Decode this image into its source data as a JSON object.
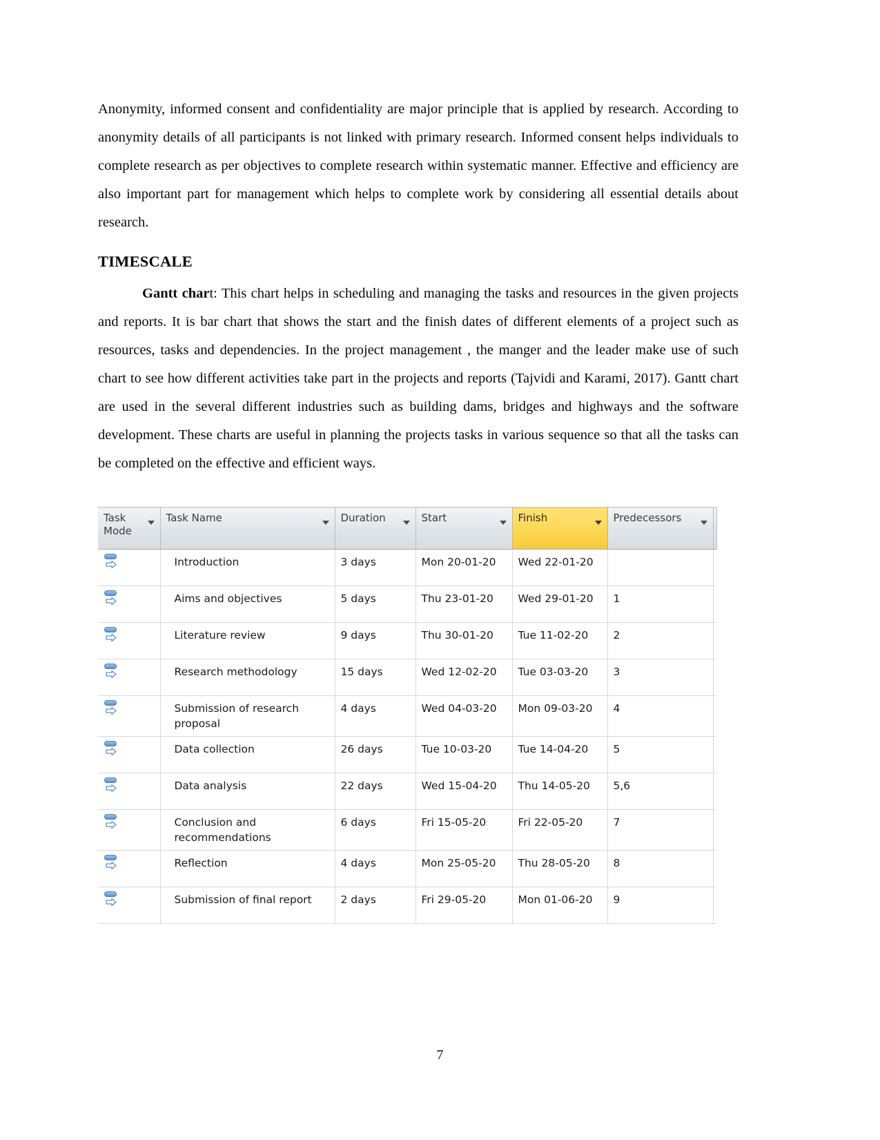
{
  "document": {
    "paragraphs": [
      {
        "id": "anonymity",
        "text": "Anonymity, informed consent and confidentiality are major principle that is applied by research. According to anonymity details of all participants is not linked with primary research. Informed consent helps individuals to complete research as per objectives to complete research within systematic manner. Effective and efficiency are also important part for management which helps to complete work by considering all essential details about research."
      }
    ],
    "heading": "TIMESCALE",
    "gantt_paragraph": {
      "lead_bold": "Gantt char",
      "rest": "t: This chart helps in scheduling and managing the tasks and resources in the given projects and reports. It is bar chart that shows the start and the finish dates of different elements of a project such as resources, tasks and dependencies. In the project management , the manger and the leader make use of such chart to see how different activities take part in the projects  and  reports (Tajvidi and Karami,   2017). Gantt chart are used in the several different industries such as building dams, bridges and highways and the software development. These charts are useful in planning the projects tasks in  various sequence so that all the tasks can be completed on the effective and efficient ways."
    },
    "page_number": "7"
  },
  "project_table": {
    "highlight_color": "#fdd755",
    "header_color": "#e3e7eb",
    "columns": [
      {
        "key": "task_mode",
        "label": "Task Mode",
        "highlighted": false
      },
      {
        "key": "task_name",
        "label": "Task Name",
        "highlighted": false
      },
      {
        "key": "duration",
        "label": "Duration",
        "highlighted": false
      },
      {
        "key": "start",
        "label": "Start",
        "highlighted": false
      },
      {
        "key": "finish",
        "label": "Finish",
        "highlighted": true
      },
      {
        "key": "predecessors",
        "label": "Predecessors",
        "highlighted": false
      }
    ],
    "rows": [
      {
        "mode_icon": "auto-scheduled-icon",
        "task_name": "Introduction",
        "duration": "3 days",
        "start": "Mon 20-01-20",
        "finish": "Wed 22-01-20",
        "predecessors": ""
      },
      {
        "mode_icon": "auto-scheduled-icon",
        "task_name": "Aims and objectives",
        "duration": "5 days",
        "start": "Thu 23-01-20",
        "finish": "Wed 29-01-20",
        "predecessors": "1"
      },
      {
        "mode_icon": "auto-scheduled-icon",
        "task_name": "Literature review",
        "duration": "9 days",
        "start": "Thu 30-01-20",
        "finish": "Tue 11-02-20",
        "predecessors": "2"
      },
      {
        "mode_icon": "auto-scheduled-icon",
        "task_name": "Research methodology",
        "duration": "15 days",
        "start": "Wed 12-02-20",
        "finish": "Tue 03-03-20",
        "predecessors": "3"
      },
      {
        "mode_icon": "auto-scheduled-icon",
        "task_name": "Submission of research proposal",
        "duration": "4 days",
        "start": "Wed 04-03-20",
        "finish": "Mon 09-03-20",
        "predecessors": "4"
      },
      {
        "mode_icon": "auto-scheduled-icon",
        "task_name": "Data collection",
        "duration": "26 days",
        "start": "Tue 10-03-20",
        "finish": "Tue 14-04-20",
        "predecessors": "5"
      },
      {
        "mode_icon": "auto-scheduled-icon",
        "task_name": "Data analysis",
        "duration": "22 days",
        "start": "Wed 15-04-20",
        "finish": "Thu 14-05-20",
        "predecessors": "5,6"
      },
      {
        "mode_icon": "auto-scheduled-icon",
        "task_name": "Conclusion and recommendations",
        "duration": "6 days",
        "start": "Fri 15-05-20",
        "finish": "Fri 22-05-20",
        "predecessors": "7"
      },
      {
        "mode_icon": "auto-scheduled-icon",
        "task_name": "Reflection",
        "duration": "4 days",
        "start": "Mon 25-05-20",
        "finish": "Thu 28-05-20",
        "predecessors": "8"
      },
      {
        "mode_icon": "auto-scheduled-icon",
        "task_name": "Submission of final report",
        "duration": "2 days",
        "start": "Fri 29-05-20",
        "finish": "Mon 01-06-20",
        "predecessors": "9"
      }
    ]
  }
}
